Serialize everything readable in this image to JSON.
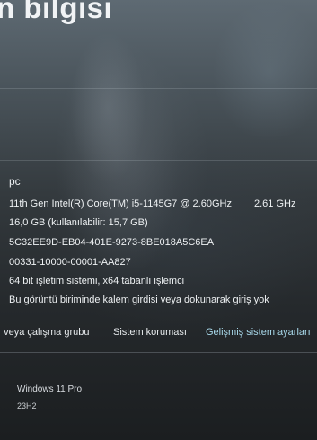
{
  "header": {
    "title": "n bilgisi"
  },
  "device": {
    "name": "pc",
    "processor": "11th Gen Intel(R) Core(TM) i5-1145G7 @ 2.60GHz",
    "processor_speed": "2.61 GHz",
    "ram": "16,0 GB (kullanılabilir: 15,7 GB)",
    "device_id": "5C32EE9D-EB04-401E-9273-8BE018A5C6EA",
    "product_id": "00331-10000-00001-AA827",
    "system_type": "64 bit işletim sistemi, x64 tabanlı işlemci",
    "pen_touch": "Bu görüntü biriminde kalem girdisi veya dokunarak giriş yok"
  },
  "links": {
    "workgroup": "ı veya çalışma grubu",
    "system_protection": "Sistem koruması",
    "advanced_settings": "Gelişmiş sistem ayarları"
  },
  "windows": {
    "edition": "Windows 11 Pro",
    "version": "23H2"
  },
  "colors": {
    "link_accent": "#a8d8ea",
    "text": "#eef1f3"
  }
}
